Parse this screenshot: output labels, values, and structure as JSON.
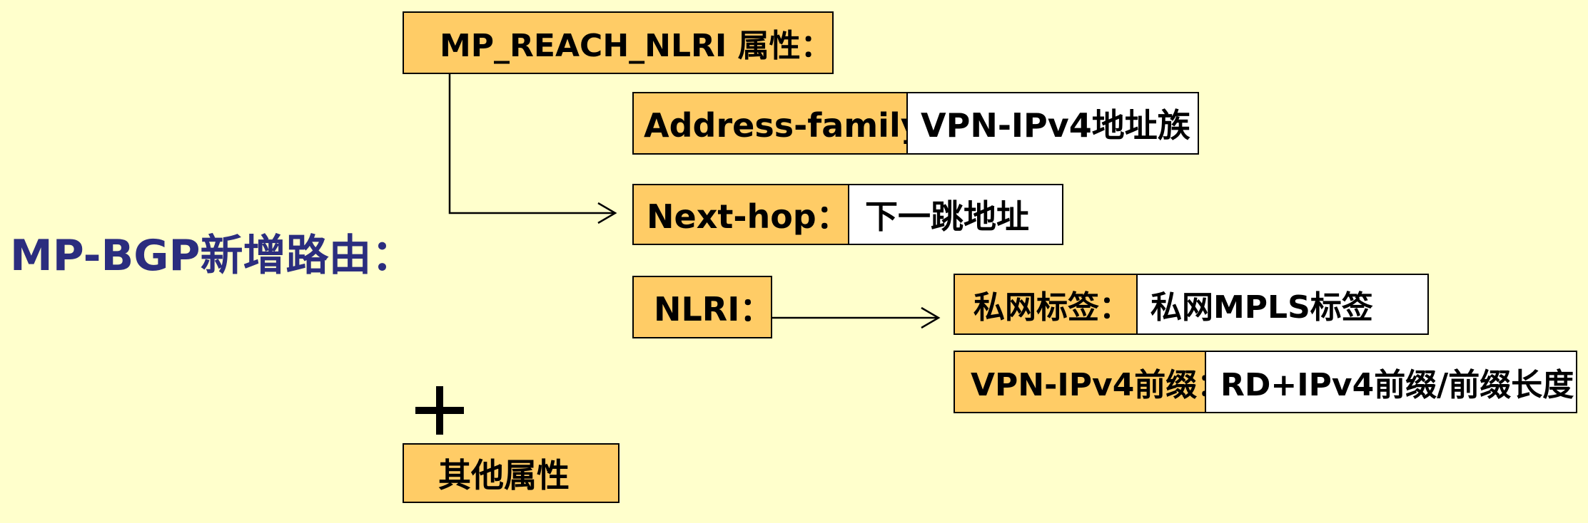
{
  "title": "MP-BGP新增路由：",
  "mp_reach": {
    "label": "MP_REACH_NLRI 属性："
  },
  "address_family": {
    "label": "Address-family：",
    "value": "VPN-IPv4地址族"
  },
  "next_hop": {
    "label": "Next-hop：",
    "value": "下一跳地址"
  },
  "nlri": {
    "label": "NLRI："
  },
  "private_label": {
    "label": "私网标签：",
    "value": "私网MPLS标签"
  },
  "vpn_prefix": {
    "label": "VPN-IPv4前缀：",
    "value": "RD+IPv4前缀/前缀长度"
  },
  "plus_sign": "+",
  "other_attrs": {
    "label": "其他属性"
  }
}
